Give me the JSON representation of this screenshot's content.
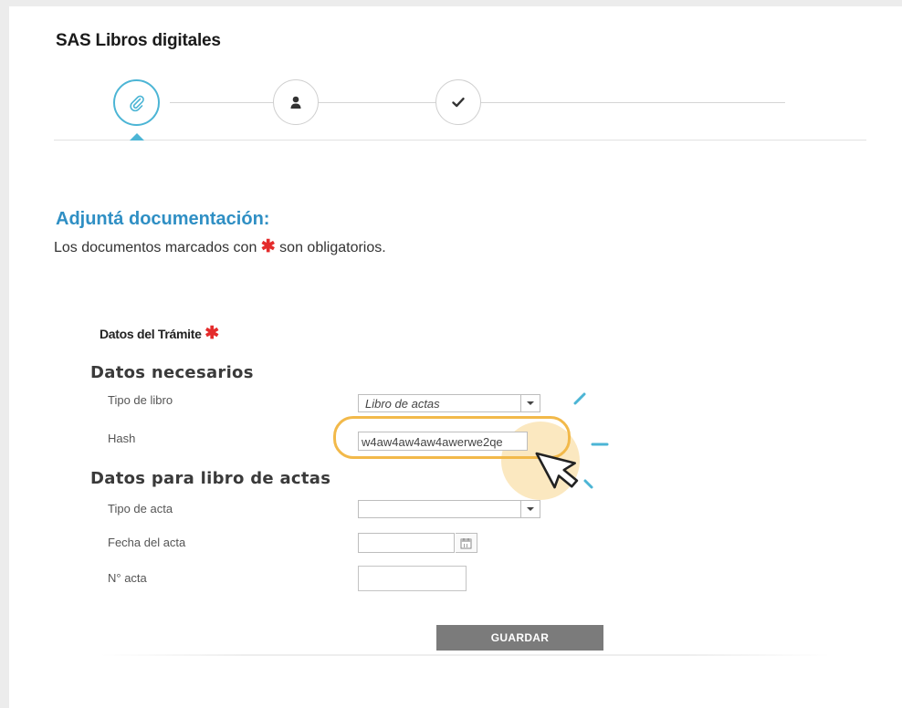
{
  "app": {
    "title": "SAS Libros digitales"
  },
  "stepper": {
    "steps": [
      {
        "icon": "paperclip-icon",
        "state": "active"
      },
      {
        "icon": "user-icon",
        "state": "pending"
      },
      {
        "icon": "check-icon",
        "state": "pending"
      }
    ]
  },
  "section": {
    "title": "Adjuntá documentación:",
    "subtitle_before": "Los documentos marcados con",
    "required_mark": "✱",
    "subtitle_after": "son obligatorios."
  },
  "tramite": {
    "label": "Datos del Trámite",
    "required_mark": "✱"
  },
  "groups": {
    "necesarios": {
      "title": "Datos necesarios",
      "tipo_libro_label": "Tipo de libro",
      "tipo_libro_value": "Libro de actas",
      "hash_label": "Hash",
      "hash_value": "w4aw4aw4aw4awerwe2qe"
    },
    "actas": {
      "title": "Datos para libro de actas",
      "tipo_acta_label": "Tipo de acta",
      "tipo_acta_value": "",
      "fecha_label": "Fecha del acta",
      "fecha_value": "",
      "numero_label": "N° acta",
      "numero_value": ""
    }
  },
  "actions": {
    "save_label": "GUARDAR"
  },
  "colors": {
    "accent": "#2f8fc4",
    "highlight": "#f2b94a",
    "required": "#e42b2b",
    "button": "#7b7b7b"
  }
}
